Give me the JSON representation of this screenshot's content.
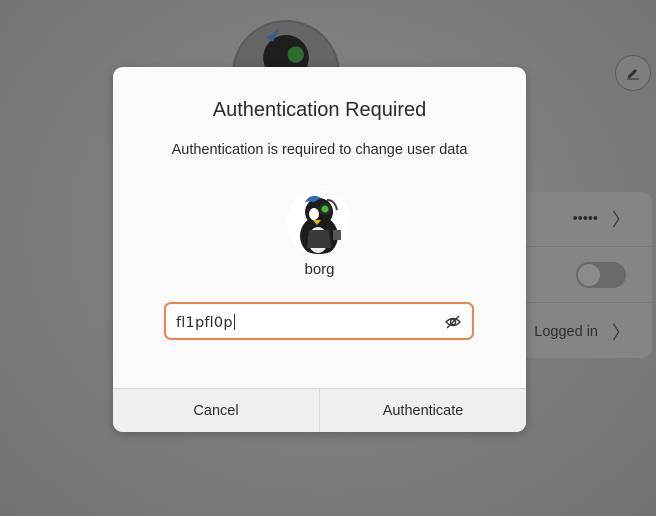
{
  "background": {
    "rows": [
      {
        "value": "•••••",
        "chevron": "〉"
      },
      {
        "value": "",
        "toggle": false
      },
      {
        "value": "Logged in",
        "chevron": "〉"
      }
    ],
    "edit_icon": "pencil-icon"
  },
  "dialog": {
    "title": "Authentication Required",
    "subtitle": "Authentication is required to change user data",
    "username": "borg",
    "password_value": "fl1pfl0p",
    "password_icon": "eye-slash-icon",
    "cancel_label": "Cancel",
    "authenticate_label": "Authenticate",
    "accent_color": "#e9854c"
  }
}
